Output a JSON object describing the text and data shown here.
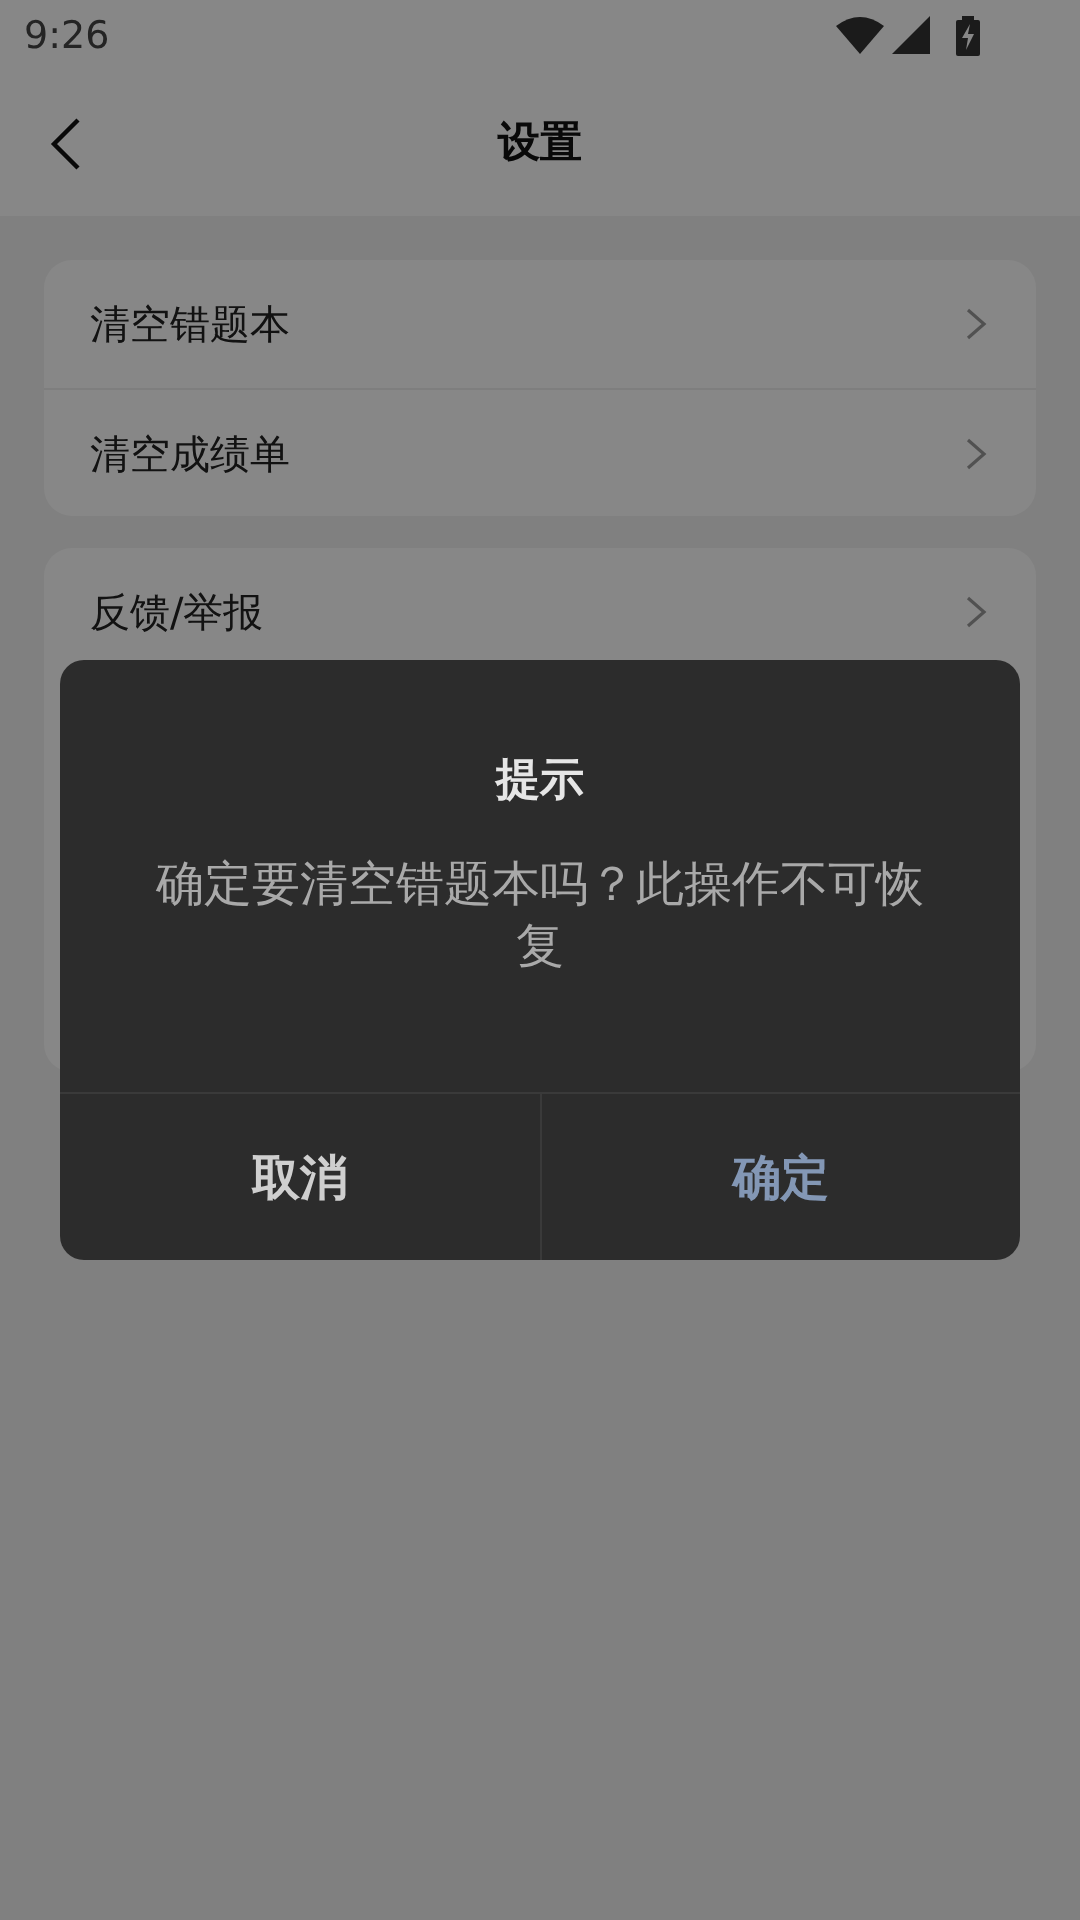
{
  "status_bar": {
    "time": "9:26"
  },
  "header": {
    "title": "设置"
  },
  "groups": [
    {
      "items": [
        {
          "label": "清空错题本"
        },
        {
          "label": "清空成绩单"
        }
      ]
    },
    {
      "items": [
        {
          "label": "反馈/举报"
        }
      ]
    }
  ],
  "dialog": {
    "title": "提示",
    "message": "确定要清空错题本吗？此操作不可恢复",
    "buttons": [
      {
        "label": "取消",
        "kind": "cancel"
      },
      {
        "label": "确定",
        "kind": "confirm"
      }
    ]
  }
}
